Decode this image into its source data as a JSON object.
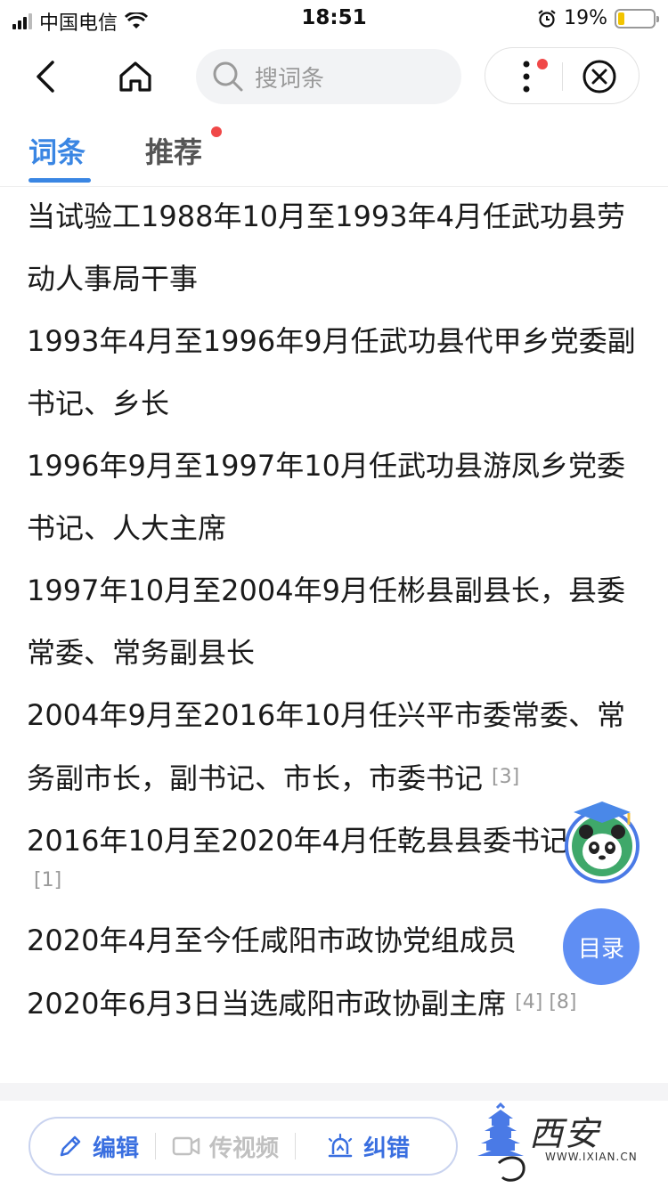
{
  "status_bar": {
    "carrier": "中国电信",
    "time": "18:51",
    "battery_percent": "19%",
    "battery_level": 0.19
  },
  "nav": {
    "search_placeholder": "搜词条"
  },
  "tabs": [
    {
      "label": "词条",
      "active": true
    },
    {
      "label": "推荐",
      "active": false,
      "has_dot": true
    }
  ],
  "content": {
    "paragraphs": [
      {
        "text": "当试验工1988年10月至1993年4月任武功县劳动人事局干事",
        "ref": ""
      },
      {
        "text": "1993年4月至1996年9月任武功县代甲乡党委副书记、乡长",
        "ref": ""
      },
      {
        "text": "1996年9月至1997年10月任武功县游凤乡党委书记、人大主席",
        "ref": ""
      },
      {
        "text": "1997年10月至2004年9月任彬县副县长，县委常委、常务副县长",
        "ref": ""
      },
      {
        "text": "2004年9月至2016年10月任兴平市委常委、常务副市长，副书记、市长，市委书记",
        "ref": "[3]"
      },
      {
        "text": "2016年10月至2020年4月任乾县县委书记",
        "ref": "[1]"
      },
      {
        "text": "2020年4月至今任咸阳市政协党组成员",
        "ref": ""
      },
      {
        "text": "2020年6月3日当选咸阳市政协副主席",
        "ref": "[4] [8]"
      }
    ]
  },
  "floating": {
    "toc_label": "目录"
  },
  "bottom": {
    "edit_label": "编辑",
    "video_label": "传视频",
    "fix_label": "纠错"
  },
  "watermark": {
    "text": "西安",
    "url": "WWW.IXIAN.CN"
  },
  "colors": {
    "accent": "#3a86e3",
    "toc_button": "#5f8ef3",
    "red_dot": "#f04848"
  }
}
